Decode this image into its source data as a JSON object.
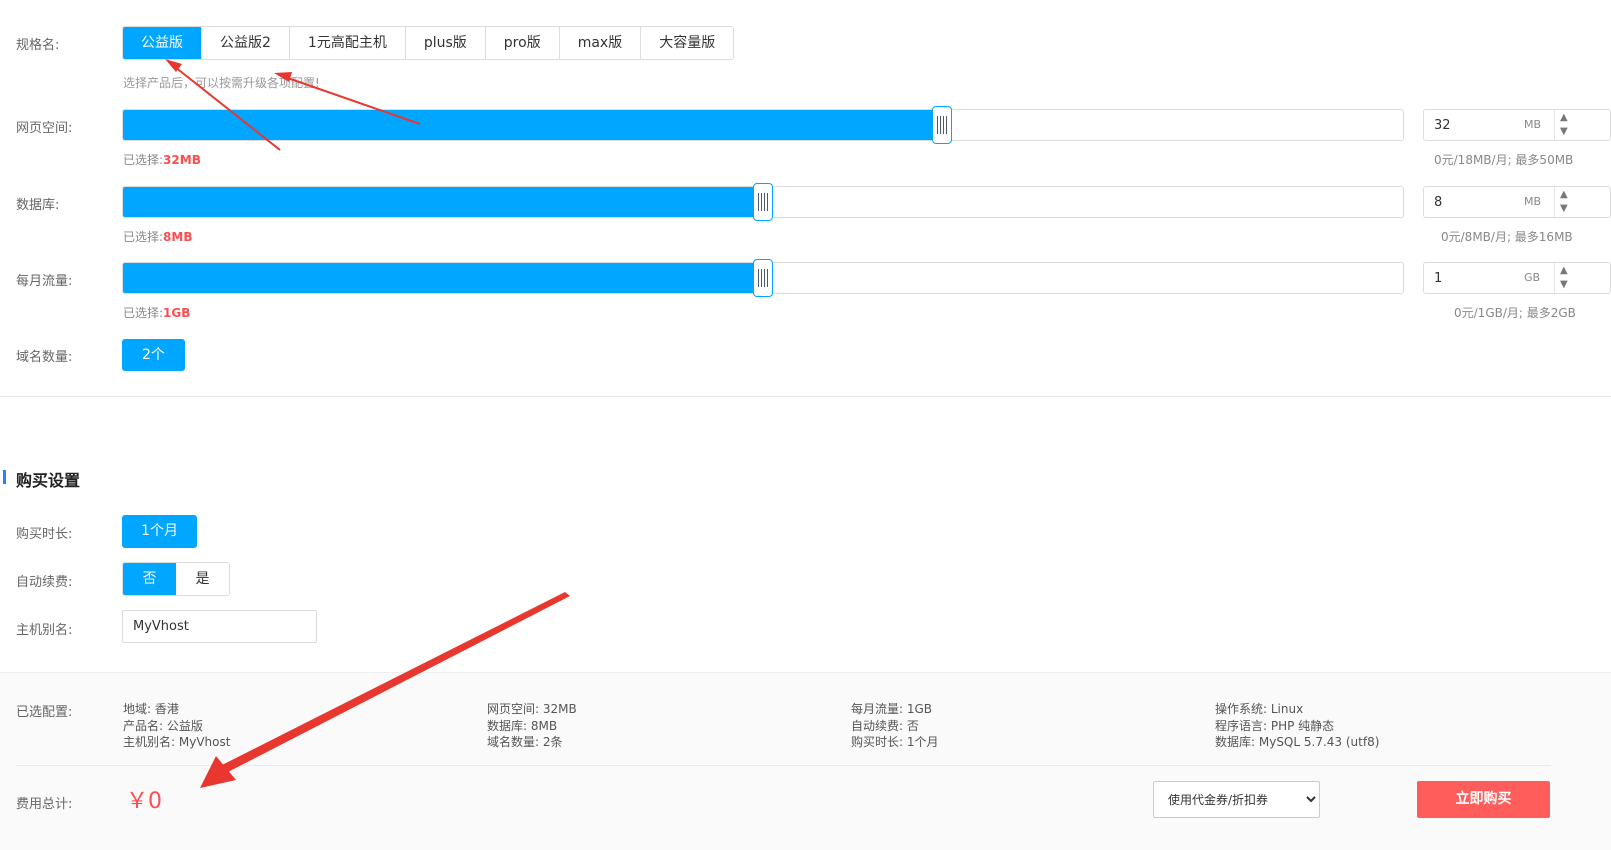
{
  "spec": {
    "label": "规格名:",
    "options": [
      "公益版",
      "公益版2",
      "1元高配主机",
      "plus版",
      "pro版",
      "max版",
      "大容量版"
    ],
    "active_index": 0,
    "hint": "选择产品后，可以按需升级各项配置!"
  },
  "web_space": {
    "label": "网页空间:",
    "selected_prefix": "已选择:",
    "selected_value": "32MB",
    "input_value": "32",
    "unit": "MB",
    "price_note": "0元/18MB/月; 最多50MB",
    "fill_fraction": 0.64
  },
  "database": {
    "label": "数据库:",
    "selected_prefix": "已选择:",
    "selected_value": "8MB",
    "input_value": "8",
    "unit": "MB",
    "price_note": "0元/8MB/月; 最多16MB",
    "fill_fraction": 0.5
  },
  "traffic": {
    "label": "每月流量:",
    "selected_prefix": "已选择:",
    "selected_value": "1GB",
    "input_value": "1",
    "unit": "GB",
    "price_note": "0元/1GB/月; 最多2GB",
    "fill_fraction": 0.5
  },
  "domains": {
    "label": "域名数量:",
    "value": "2个"
  },
  "purchase": {
    "title": "购买设置",
    "duration_label": "购买时长:",
    "duration_value": "1个月",
    "auto_renew_label": "自动续费:",
    "auto_renew_options": [
      "否",
      "是"
    ],
    "alias_label": "主机别名:",
    "alias_value": "MyVhost"
  },
  "summary": {
    "label": "已选配置:",
    "col1": [
      "地域: 香港",
      "产品名: 公益版",
      "主机别名: MyVhost"
    ],
    "col2": [
      "网页空间: 32MB",
      "数据库: 8MB",
      "域名数量: 2条"
    ],
    "col3": [
      "每月流量: 1GB",
      "自动续费: 否",
      "购买时长: 1个月"
    ],
    "col4": [
      "操作系统: Linux",
      "程序语言: PHP 纯静态",
      "数据库: MySQL 5.7.43 (utf8)"
    ],
    "cost_label": "费用总计:",
    "cost_value": "￥0",
    "coupon_option": "使用代金券/折扣券",
    "buy_label": "立即购买"
  },
  "colors": {
    "accent": "#00a6ff",
    "danger": "#ff4d4f",
    "buy": "#ff5c5c",
    "annotation": "#e8372f"
  }
}
